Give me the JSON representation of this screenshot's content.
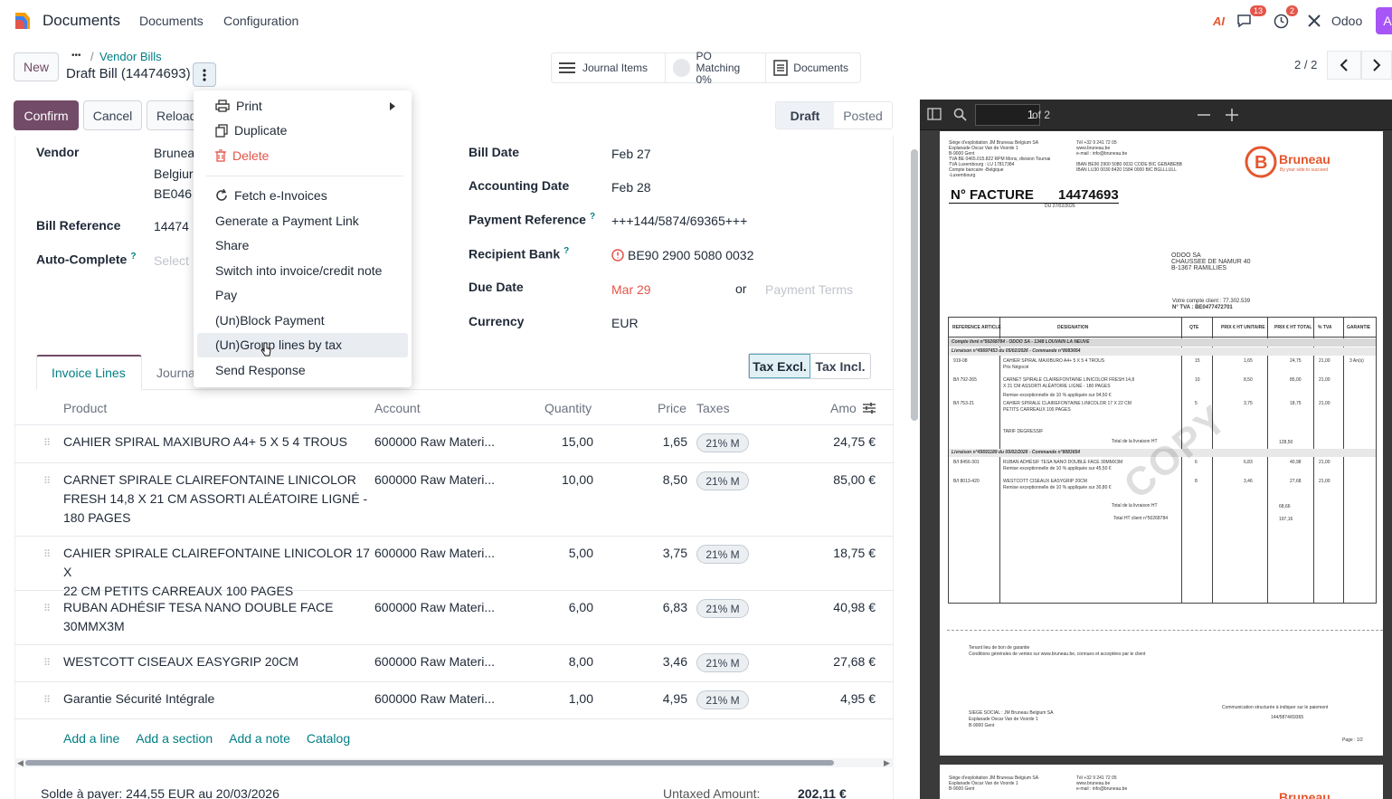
{
  "topbar": {
    "app_name": "Documents",
    "menu": [
      "Documents",
      "Configuration"
    ],
    "messages_badge": "13",
    "activity_badge": "2",
    "company": "Odoo",
    "avatar_letter": "A",
    "ai_label": "AI"
  },
  "control": {
    "new_label": "New",
    "breadcrumb_dots": "•••",
    "breadcrumb_sep": "/",
    "breadcrumb_parent": "Vendor Bills",
    "record_title": "Draft Bill (14474693)",
    "confirm_label": "Confirm",
    "cancel_label": "Cancel",
    "reload_label": "Reload",
    "pager": "2 / 2"
  },
  "smart_buttons": {
    "journal_items": "Journal Items",
    "po_matching": "PO Matching",
    "po_matching_value": "0%",
    "documents": "Documents"
  },
  "statusbar": {
    "draft": "Draft",
    "posted": "Posted"
  },
  "form": {
    "vendor_label": "Vendor",
    "vendor_lines": [
      "Brunea",
      "Belgiur",
      "BE046"
    ],
    "bill_reference_label": "Bill Reference",
    "bill_reference_value": "14474",
    "auto_complete_label": "Auto-Complete",
    "auto_complete_placeholder": "Select",
    "bill_date_label": "Bill Date",
    "bill_date_value": "Feb 27",
    "accounting_date_label": "Accounting Date",
    "accounting_date_value": "Feb 28",
    "payment_reference_label": "Payment Reference",
    "payment_reference_value": "+++144/5874/69365+++",
    "recipient_bank_label": "Recipient Bank",
    "recipient_bank_value": "BE90 2900 5080 0032",
    "due_date_label": "Due Date",
    "due_date_value": "Mar 29",
    "or_label": "or",
    "payment_terms_placeholder": "Payment Terms",
    "currency_label": "Currency",
    "currency_value": "EUR",
    "help_mark": "?"
  },
  "tabs": {
    "invoice_lines": "Invoice Lines",
    "journal": "Journa"
  },
  "tax_toggle": {
    "excl": "Tax Excl.",
    "incl": "Tax Incl."
  },
  "table": {
    "headers": {
      "product": "Product",
      "account": "Account",
      "quantity": "Quantity",
      "price": "Price",
      "taxes": "Taxes",
      "amount": "Amo"
    },
    "rows": [
      {
        "product": [
          "CAHIER SPIRAL MAXIBURO A4+ 5 X 5 4 TROUS"
        ],
        "account": "600000 Raw Materi...",
        "quantity": "15,00",
        "price": "1,65",
        "tax": "21% M",
        "amount": "24,75 €"
      },
      {
        "product": [
          "CARNET SPIRALE CLAIREFONTAINE LINICOLOR",
          "FRESH 14,8  X 21 CM ASSORTI ALÉATOIRE LIGNÉ -",
          "180 PAGES"
        ],
        "account": "600000 Raw Materi...",
        "quantity": "10,00",
        "price": "8,50",
        "tax": "21% M",
        "amount": "85,00 €"
      },
      {
        "product": [
          "CAHIER SPIRALE CLAIREFONTAINE LINICOLOR 17 X",
          "22 CM  PETITS CARREAUX 100 PAGES"
        ],
        "account": "600000 Raw Materi...",
        "quantity": "5,00",
        "price": "3,75",
        "tax": "21% M",
        "amount": "18,75 €"
      },
      {
        "product": [
          "RUBAN ADHÉSIF TESA NANO DOUBLE FACE",
          "30MMX3M"
        ],
        "account": "600000 Raw Materi...",
        "quantity": "6,00",
        "price": "6,83",
        "tax": "21% M",
        "amount": "40,98 €"
      },
      {
        "product": [
          "WESTCOTT CISEAUX EASYGRIP 20CM"
        ],
        "account": "600000 Raw Materi...",
        "quantity": "8,00",
        "price": "3,46",
        "tax": "21% M",
        "amount": "27,68 €"
      },
      {
        "product": [
          "Garantie Sécurité Intégrale"
        ],
        "account": "600000 Raw Materi...",
        "quantity": "1,00",
        "price": "4,95",
        "tax": "21% M",
        "amount": "4,95 €"
      }
    ],
    "add_links": [
      "Add a line",
      "Add a section",
      "Add a note",
      "Catalog"
    ]
  },
  "footer": {
    "balance_text": "Solde à payer: 244,55 EUR au 20/03/2026",
    "untaxed_label": "Untaxed Amount:",
    "untaxed_value": "202,11 €"
  },
  "dropdown": {
    "print": "Print",
    "duplicate": "Duplicate",
    "delete": "Delete",
    "fetch_einvoices": "Fetch e-Invoices",
    "payment_link": "Generate a Payment Link",
    "share": "Share",
    "switch": "Switch into invoice/credit note",
    "pay": "Pay",
    "block_payment": "(Un)Block Payment",
    "group_lines": "(Un)Group lines by tax",
    "send_response": "Send Response"
  },
  "pdf": {
    "page_current": "1",
    "page_total": "of 2",
    "invoice_no_label": "N° FACTURE",
    "invoice_no": "14474693",
    "invoice_date": "DU 27/02/2026",
    "brand": "Bruneau",
    "brand_tagline": "By your side to succeed",
    "customer": [
      "ODOO SA",
      "CHAUSSEE DE NAMUR 40",
      "B-1367 RAMILLIES"
    ],
    "customer_account": "Votre compte client : 77.302.539",
    "customer_vat": "N° TVA : BE0477472701",
    "seller_block": [
      "Siège d'exploitation JM Bruneau Belgium SA",
      "Esplanade Oscar Van de Voorde 1",
      "B-9000 Gent",
      "TVA BE 0465.015.822 RPM Mons, division Tournai",
      "TVA Luxembourg : LU 17817384",
      "Compte bancaire    -Belgique",
      "                  -Luxembourg"
    ],
    "contact_block": [
      "Tél +32 9 241 72 05",
      "www.bruneau.be",
      "e-mail : info@bruneau.be",
      "",
      "IBAN BE90 2900 5080 0032 CODE BIC GEBABEBB",
      "IBAN LU30 0030 8420 1584 0000 BIC BGLLLULL"
    ],
    "table_headers": [
      "REFERENCE ARTICLE",
      "DESIGNATION",
      "QTE",
      "PRIX € HT UNITAIRE",
      "PRIX € HT TOTAL",
      "% TVA",
      "GARANTIE"
    ],
    "band1": "Compte livré n°50268784 - ODOO SA - 1348 LOUVAIN LA NEUVE",
    "band2": "Livraison n°45697453 du 05/02/2026 - Commande n°8083654",
    "band3": "Livraison n°45691189 du 05/02/2026 - Commande n°8083654",
    "lines": [
      {
        "ref": "919-08",
        "desc": "CAHIER SPIRAL MAXIBURO A4+ 5 X 5 4 TROUS",
        "desc2": "Prix Négocié",
        "qte": "15",
        "pu": "1,65",
        "pt": "24,75",
        "tva": "21,00",
        "gar": "3 An(s)"
      },
      {
        "ref": "B/I  792-265",
        "desc": "CARNET SPIRALE CLAIREFONTAINE LINICOLOR FRESH 14,8",
        "desc2": "X 21 CM ASSORTI ALÉATOIRE LIGNÉ - 180 PAGES",
        "qte": "10",
        "pu": "8,50",
        "pt": "85,00",
        "tva": "21,00",
        "gar": ""
      },
      {
        "ref": "B/I  753-21",
        "desc": "CAHIER SPIRALE CLAIREFONTAINE LINICOLOR 17 X 22 CM",
        "desc2": "PETITS CARREAUX 100 PAGES",
        "qte": "5",
        "pu": "3,75",
        "pt": "18,75",
        "tva": "21,00",
        "gar": ""
      },
      {
        "ref": "B/I  8456-301",
        "desc": "RUBAN ADHÉSIF TESA NANO DOUBLE FACE 30MMX3M",
        "desc2": "Remise exceptionnelle de 10 % appliquée sur 45,50 €",
        "qte": "6",
        "pu": "6,83",
        "pt": "40,98",
        "tva": "21,00",
        "gar": ""
      },
      {
        "ref": "B/I  8013-420",
        "desc": "WESTCOTT CISEAUX EASYGRIP 20CM",
        "desc2": "Remise exceptionnelle de 10 % appliquée sur 30,80 €",
        "qte": "8",
        "pu": "3,46",
        "pt": "27,68",
        "tva": "21,00",
        "gar": ""
      }
    ],
    "remise_note": "Remise exceptionnelle de 10 % appliquée sur 94,50 €",
    "tarif": "TARIF DEGRESSIF",
    "total_livraison_label": "Total de la livraison HT",
    "total_livraison_1": "128,50",
    "total_livraison_2": "68,66",
    "total_client_label": "Total HT client n°50268784",
    "total_client": "197,16",
    "watermark": "COPY",
    "conditions_1": "Tenant lieu de bon de garantie",
    "conditions_2": "Conditions générales de ventes sur www.bruneau.be, connues et acceptées par le client",
    "siege": [
      "SIEGE SOCIAL : JM Bruneau Belgium SA",
      "Esplanade Oscar Van de Voorde 1",
      "B-9000 Gent"
    ],
    "communication_label": "Communication structurée à indiquer sur le paiement",
    "communication_value": "144/5874/69365",
    "page_label": "Page : 1/2"
  },
  "colors": {
    "primary": "#714b67",
    "link": "#017e84",
    "danger": "#e4554a",
    "brand": "#e4572e"
  }
}
